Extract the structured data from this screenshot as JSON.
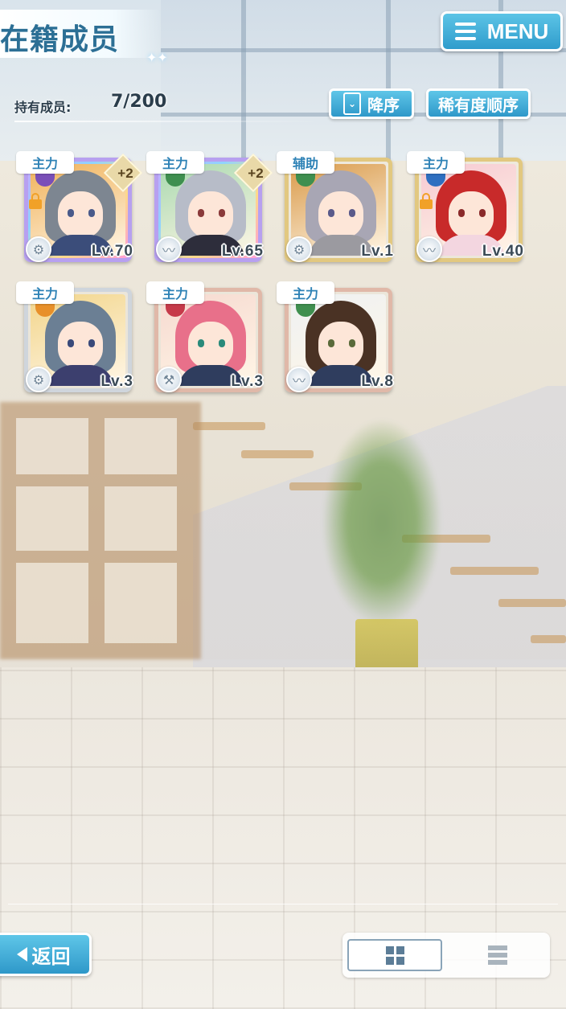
{
  "header": {
    "title": "在籍成员",
    "menu_label": "MENU"
  },
  "member_count": {
    "label": "持有成员:",
    "value": "7/200"
  },
  "sort": {
    "order_label": "降序",
    "mode_label": "稀有度顺序"
  },
  "members": [
    {
      "role": "主力",
      "level": "Lv.70",
      "plus": "+2",
      "locked": true,
      "frame": "rainbow",
      "attr_color": "#7a4fb8",
      "type_icon": "gear-icon",
      "hair": "#7d8691",
      "eyes": "#4a5a8a",
      "bg": "#f0b25a",
      "outfit": "#3b4d7a"
    },
    {
      "role": "主力",
      "level": "Lv.65",
      "plus": "+2",
      "locked": false,
      "frame": "rainbow",
      "attr_color": "#3f8f4f",
      "type_icon": "feather-icon",
      "hair": "#b7bcc8",
      "eyes": "#8a3a3a",
      "bg": "#a9d9b0",
      "outfit": "#2d2d3b"
    },
    {
      "role": "辅助",
      "level": "Lv.1",
      "plus": "",
      "locked": false,
      "frame": "gold",
      "attr_color": "#3f8f4f",
      "type_icon": "gear-icon",
      "hair": "#a8a6b4",
      "eyes": "#5a5a8a",
      "bg": "#d99a4a",
      "outfit": "#9b9aa0"
    },
    {
      "role": "主力",
      "level": "Lv.40",
      "plus": "",
      "locked": true,
      "frame": "gold",
      "attr_color": "#2e6fc0",
      "type_icon": "feather-icon",
      "hair": "#c82a2a",
      "eyes": "#8a2a2a",
      "bg": "#f6c9d2",
      "outfit": "#f3d6e0"
    },
    {
      "role": "主力",
      "level": "Lv.3",
      "plus": "",
      "locked": false,
      "frame": "silver",
      "attr_color": "#e8902a",
      "type_icon": "gear-icon",
      "hair": "#6b7f94",
      "eyes": "#3a4a7a",
      "bg": "#f2d58a",
      "outfit": "#3c3f6e"
    },
    {
      "role": "主力",
      "level": "Lv.3",
      "plus": "",
      "locked": false,
      "frame": "bronze",
      "attr_color": "#c63a4a",
      "type_icon": "hammer-icon",
      "hair": "#e8708a",
      "eyes": "#2a8a7a",
      "bg": "#f6d9d0",
      "outfit": "#2f3d5e"
    },
    {
      "role": "主力",
      "level": "Lv.8",
      "plus": "",
      "locked": false,
      "frame": "bronze",
      "attr_color": "#3f8f4f",
      "type_icon": "feather-icon",
      "hair": "#4a3224",
      "eyes": "#5a6a3a",
      "bg": "#eef1f3",
      "outfit": "#2f3d5e"
    }
  ],
  "footer": {
    "back_label": "返回",
    "view_mode": "grid"
  }
}
